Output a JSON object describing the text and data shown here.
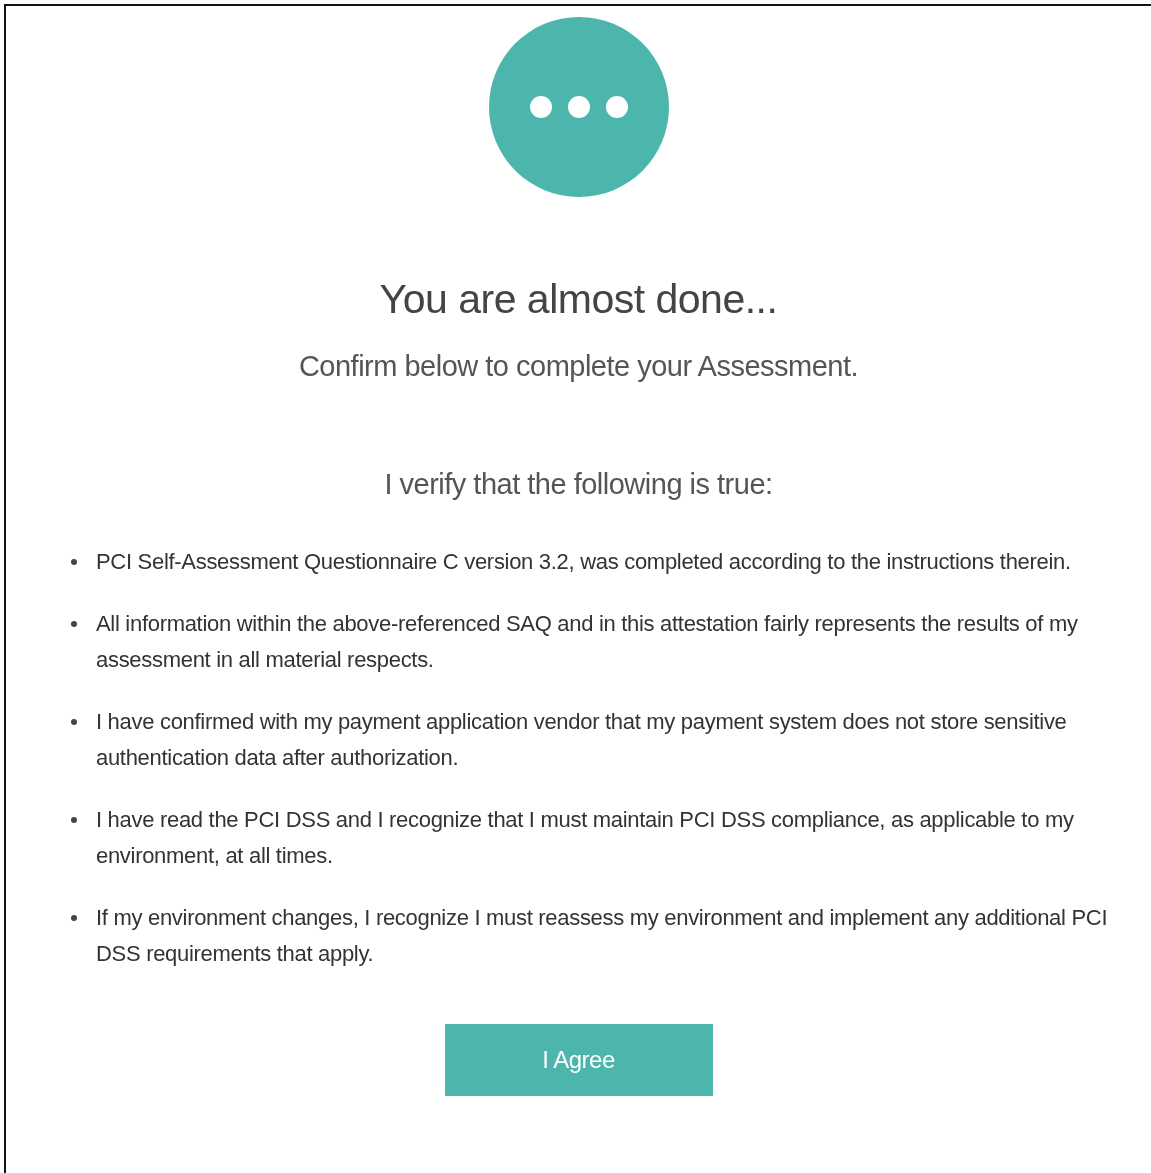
{
  "status_icon": {
    "kind": "pending"
  },
  "title": "You are almost done...",
  "subtitle": "Confirm below to complete your Assessment.",
  "verify_heading": "I verify that the following is true:",
  "statements": [
    "PCI Self-Assessment Questionnaire C version 3.2, was completed according to the instructions therein.",
    "All information within the above-referenced SAQ and in this attestation fairly represents the results of my assessment in all material respects.",
    "I have confirmed with my payment application vendor that my payment system does not store sensitive authentication data after authorization.",
    "I have read the PCI DSS and I recognize that I must maintain PCI DSS compliance, as applicable to my environment, at all times.",
    "If my environment changes, I recognize I must reassess my environment and implement any additional PCI DSS requirements that apply."
  ],
  "agree_button": "I Agree"
}
